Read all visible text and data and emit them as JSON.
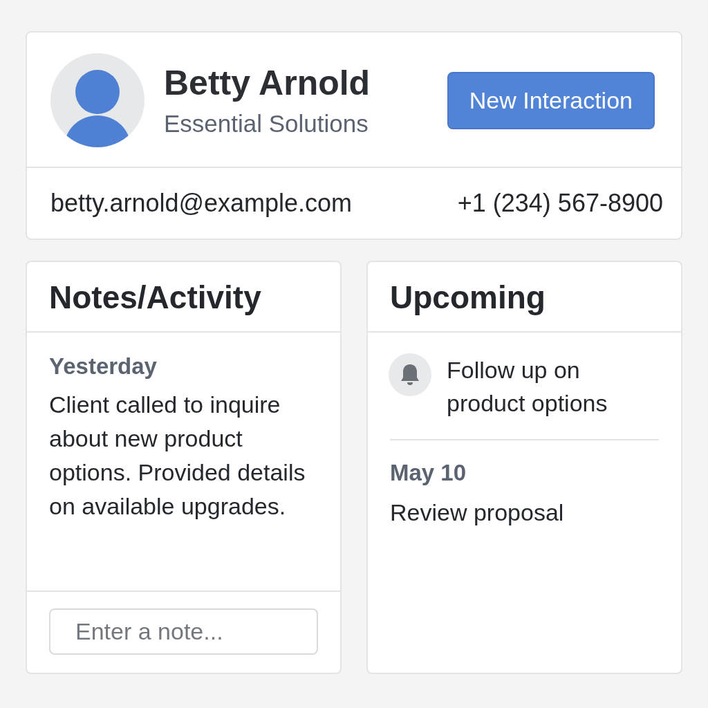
{
  "contact": {
    "name": "Betty Arnold",
    "company": "Essential Solutions",
    "email": "betty.arnold@example.com",
    "phone": "+1 (234) 567-8900",
    "action": "New Interaction"
  },
  "notes": {
    "title": "Notes/Activity",
    "entries": [
      {
        "date": "Yesterday",
        "text": "Client called to inquire about new product options. Provided details on available upgrades."
      }
    ],
    "note_input": {
      "placeholder": "Enter a note..."
    }
  },
  "upcoming": {
    "title": "Upcoming",
    "items": [
      {
        "kind": "reminder",
        "text": "Follow up on product options"
      },
      {
        "kind": "dated",
        "date": "May 10",
        "text": "Review proposal"
      }
    ]
  }
}
